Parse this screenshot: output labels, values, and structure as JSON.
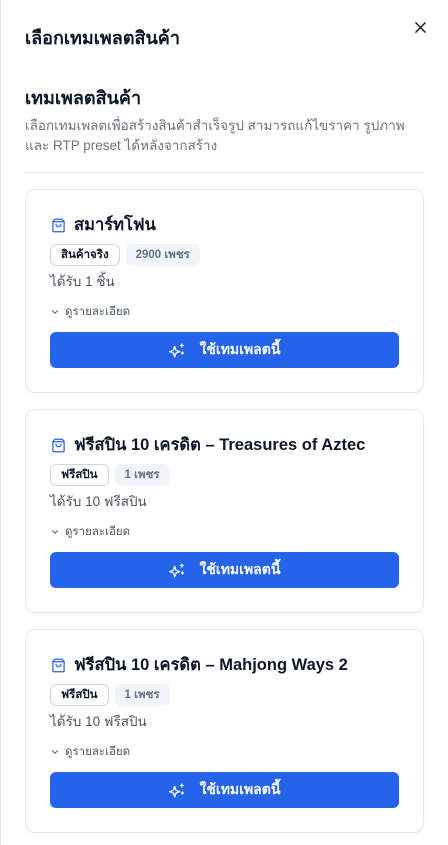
{
  "header": {
    "title": "เลือกเทมเพลตสินค้า"
  },
  "section": {
    "title": "เทมเพลตสินค้า",
    "description": "เลือกเทมเพลตเพื่อสร้างสินค้าสำเร็จรูป สามารถแก้ไขราคา รูปภาพ และ RTP preset ได้หลังจากสร้าง"
  },
  "cards": [
    {
      "title": "สมาร์ทโฟน",
      "type_badge": "สินค้าจริง",
      "price_badge": "2900 เพชร",
      "reward": "ได้รับ 1 ชิ้น",
      "details_label": "ดูรายละเอียด",
      "button_label": "ใช้เทมเพลตนี้"
    },
    {
      "title": "ฟรีสปิน 10 เครดิต – Treasures of Aztec",
      "type_badge": "ฟรีสปิน",
      "price_badge": "1 เพชร",
      "reward": "ได้รับ 10 ฟรีสปิน",
      "details_label": "ดูรายละเอียด",
      "button_label": "ใช้เทมเพลตนี้"
    },
    {
      "title": "ฟรีสปิน 10 เครดิต – Mahjong Ways 2",
      "type_badge": "ฟรีสปิน",
      "price_badge": "1 เพชร",
      "reward": "ได้รับ 10 ฟรีสปิน",
      "details_label": "ดูรายละเอียด",
      "button_label": "ใช้เทมเพลตนี้"
    }
  ],
  "icons": {
    "close": "close-icon",
    "card": "shopping-bag-icon",
    "details": "chevron-down-icon",
    "button": "sparkles-icon"
  },
  "colors": {
    "primary": "#2563eb",
    "text": "#0f172a",
    "muted": "#6b7280",
    "border": "#e5e7eb"
  }
}
